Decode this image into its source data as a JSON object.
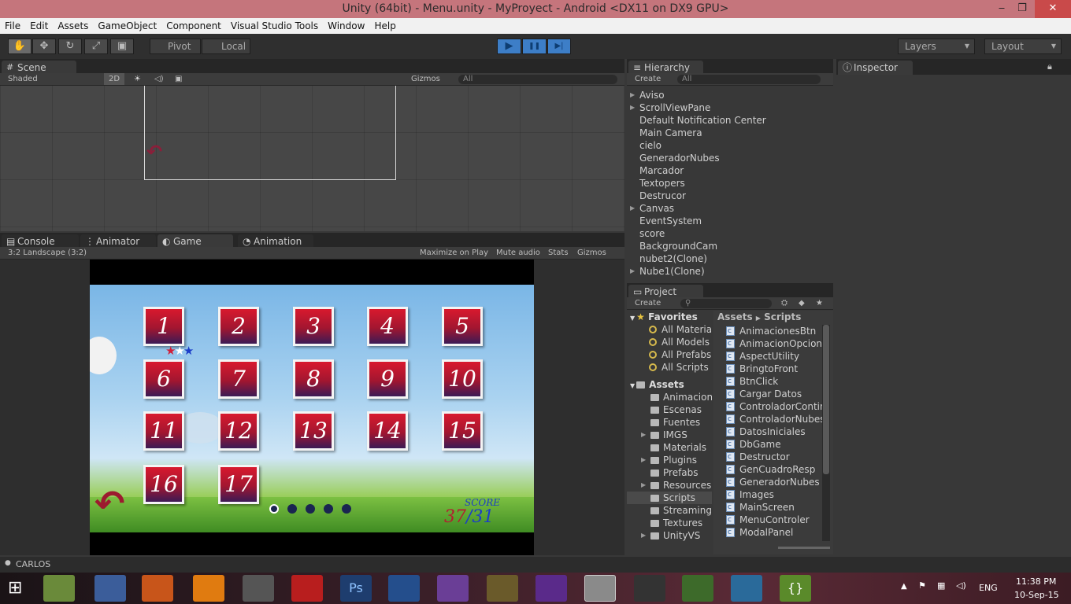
{
  "window": {
    "title": "Unity (64bit) - Menu.unity - MyProyect - Android <DX11 on DX9 GPU>",
    "min": "‒",
    "max": "❐",
    "close": "✕"
  },
  "menu": [
    "File",
    "Edit",
    "Assets",
    "GameObject",
    "Component",
    "Visual Studio Tools",
    "Window",
    "Help"
  ],
  "toolbar": {
    "hand": "✋",
    "move": "✥",
    "rotate": "↻",
    "scale": "⤢",
    "rect": "▣",
    "pivot": "Pivot",
    "local": "Local",
    "play": "▶",
    "pause": "❚❚",
    "step": "▶|",
    "layers": "Layers",
    "layout": "Layout"
  },
  "scene": {
    "tab": "Scene",
    "shading": "Shaded",
    "mode2d": "2D",
    "gizmos": "Gizmos",
    "search": "All"
  },
  "game": {
    "tabs": [
      "Console",
      "Animator",
      "Game",
      "Animation"
    ],
    "aspect": "3:2 Landscape (3:2)",
    "maximize": "Maximize on Play",
    "mute": "Mute audio",
    "stats": "Stats",
    "gizmos": "Gizmos",
    "tiles": [
      "1",
      "2",
      "3",
      "4",
      "5",
      "6",
      "7",
      "8",
      "9",
      "10",
      "11",
      "12",
      "13",
      "14",
      "15",
      "16",
      "17"
    ],
    "score_label": "SCORE",
    "score_value": "37",
    "score_total": "31",
    "score_sep": "/",
    "stars": "★★★"
  },
  "hierarchy": {
    "tab": "Hierarchy",
    "create": "Create",
    "search": "All",
    "items": [
      {
        "label": "Aviso",
        "arrow": true
      },
      {
        "label": "ScrollViewPane",
        "arrow": true
      },
      {
        "label": "Default Notification Center",
        "arrow": false
      },
      {
        "label": "Main Camera",
        "arrow": false
      },
      {
        "label": "cielo",
        "arrow": false
      },
      {
        "label": "GeneradorNubes",
        "arrow": false
      },
      {
        "label": "Marcador",
        "arrow": false
      },
      {
        "label": "Textopers",
        "arrow": false
      },
      {
        "label": "Destrucor",
        "arrow": false
      },
      {
        "label": "Canvas",
        "arrow": true
      },
      {
        "label": "EventSystem",
        "arrow": false
      },
      {
        "label": "score",
        "arrow": false
      },
      {
        "label": "BackgroundCam",
        "arrow": false
      },
      {
        "label": "nubet2(Clone)",
        "arrow": false
      },
      {
        "label": "Nube1(Clone)",
        "arrow": true
      }
    ]
  },
  "project": {
    "tab": "Project",
    "create": "Create",
    "favorites": "Favorites",
    "fav_items": [
      "All Material",
      "All Models",
      "All Prefabs",
      "All Scripts"
    ],
    "assets": "Assets",
    "folders": [
      "Animacione",
      "Escenas",
      "Fuentes",
      "IMGS",
      "Materials",
      "Plugins",
      "Prefabs",
      "Resources",
      "Scripts",
      "StreamingA",
      "Textures",
      "UnityVS"
    ],
    "breadcrumb": [
      "Assets",
      "Scripts"
    ],
    "scripts": [
      "AnimacionesBtn",
      "AnimacionOpcione",
      "AspectUtility",
      "BringtoFront",
      "BtnClick",
      "Cargar Datos",
      "ControladorContin",
      "ControladorNubes",
      "DatosIniciales",
      "DbGame",
      "Destructor",
      "GenCuadroResp",
      "GeneradorNubes",
      "Images",
      "MainScreen",
      "MenuControler",
      "ModalPanel"
    ]
  },
  "inspector": {
    "tab": "Inspector"
  },
  "status": {
    "user": "CARLOS"
  },
  "taskbar": {
    "lang": "ENG",
    "time": "11:38 PM",
    "date": "10-Sep-15"
  }
}
